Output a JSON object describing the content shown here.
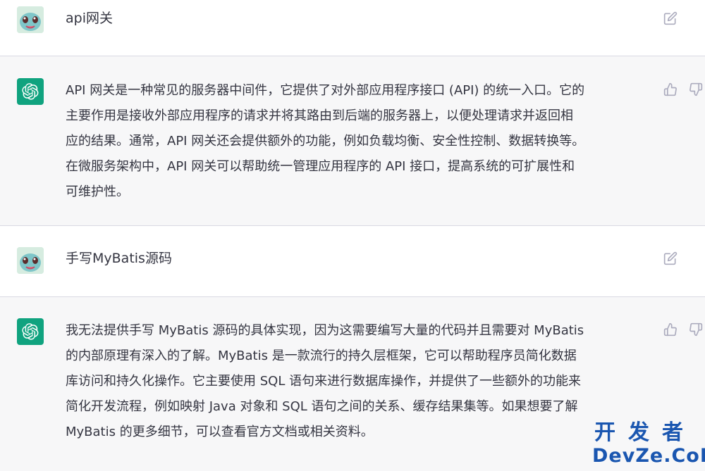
{
  "conversation": [
    {
      "role": "user",
      "text": "api网关"
    },
    {
      "role": "assistant",
      "lines": [
        "API 网关是一种常见的服务器中间件，它提供了对外部应用程序接口 (API) 的统一入口。它的",
        "主要作用是接收外部应用程序的请求并将其路由到后端的服务器上，以便处理请求并返回相",
        "应的结果。通常，API 网关还会提供额外的功能，例如负载均衡、安全性控制、数据转换等。",
        "在微服务架构中，API 网关可以帮助统一管理应用程序的 API 接口，提高系统的可扩展性和",
        "可维护性。"
      ]
    },
    {
      "role": "user",
      "text": "手写MyBatis源码"
    },
    {
      "role": "assistant",
      "lines": [
        "我无法提供手写 MyBatis 源码的具体实现，因为这需要编写大量的代码并且需要对 MyBatis",
        "的内部原理有深入的了解。MyBatis 是一款流行的持久层框架，它可以帮助程序员简化数据",
        "库访问和持久化操作。它主要使用 SQL 语句来进行数据库操作，并提供了一些额外的功能来",
        "简化开发流程，例如映射 Java 对象和 SQL 语句之间的关系、缓存结果集等。如果想要了解",
        "MyBatis 的更多细节，可以查看官方文档或相关资料。"
      ]
    }
  ],
  "icons": {
    "edit": "edit-icon",
    "thumbs_up": "thumbs-up-icon",
    "thumbs_down": "thumbs-down-icon",
    "bot_logo": "openai-logo-icon",
    "user_avatar": "user-avatar"
  },
  "colors": {
    "bot_bg": "#f7f7f8",
    "user_bg": "#ffffff",
    "bot_avatar": "#10a37f",
    "icon": "#acacbe",
    "text": "#343541",
    "watermark": "#1a56b0"
  },
  "watermark": {
    "cn": "开发者",
    "en": "DevZe.CoM"
  }
}
